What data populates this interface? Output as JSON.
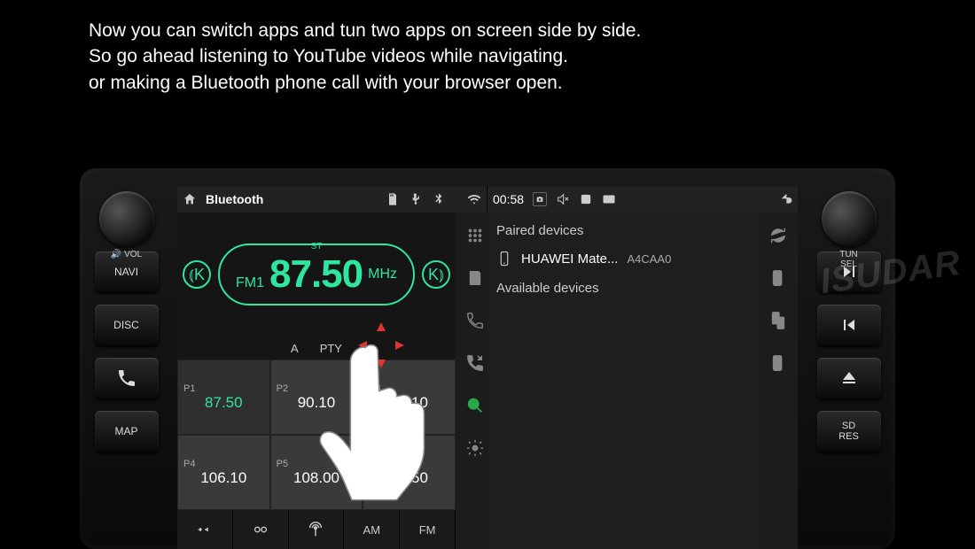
{
  "promo": {
    "line1": "Now you can switch apps and tun two apps on screen side by side.",
    "line2": "So go ahead listening to YouTube videos while navigating.",
    "line3": "or making a Bluetooth phone call with your browser open."
  },
  "device": {
    "left_knob": "VOL",
    "right_knob_top": "TUN",
    "right_knob_bottom": "SEL",
    "left_buttons": [
      "NAVI",
      "DISC",
      "",
      "MAP"
    ],
    "right_buttons_labels": {
      "sd": "SD",
      "res": "RES"
    }
  },
  "left_app": {
    "status": {
      "title": "Bluetooth"
    },
    "radio": {
      "stereo": "ST",
      "band": "FM1",
      "frequency": "87.50",
      "unit": "MHz",
      "controls": [
        "A",
        "PTY"
      ],
      "presets": [
        {
          "num": "P1",
          "freq": "87.50",
          "active": true
        },
        {
          "num": "P2",
          "freq": "90.10"
        },
        {
          "num": "P3",
          "freq": "98.10"
        },
        {
          "num": "P4",
          "freq": "106.10"
        },
        {
          "num": "P5",
          "freq": "108.00"
        },
        {
          "num": "P6",
          "freq": "87.50"
        }
      ],
      "bottom": {
        "am": "AM",
        "fm": "FM"
      }
    }
  },
  "right_app": {
    "status": {
      "time": "00:58"
    },
    "bt": {
      "paired_header": "Paired devices",
      "paired": [
        {
          "name": "HUAWEI Mate...",
          "id": "A4CAA0"
        }
      ],
      "available_header": "Available devices"
    }
  },
  "watermark": {
    "brand": "ISUDAR"
  }
}
